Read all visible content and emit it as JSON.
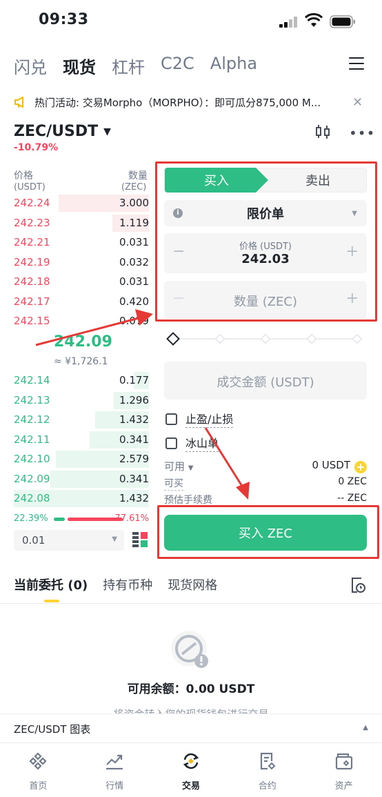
{
  "status": {
    "time": "09:33"
  },
  "top_tabs": [
    {
      "label": "闪兑"
    },
    {
      "label": "现货"
    },
    {
      "label": "杠杆"
    },
    {
      "label": "C2C"
    },
    {
      "label": "Alpha"
    }
  ],
  "notice": {
    "text": "热门活动: 交易Morpho（MORPHO）：即可瓜分875,000 M..."
  },
  "pair": {
    "symbol": "ZEC/USDT",
    "change": "-10.79%"
  },
  "orderbook": {
    "price_header": "价格",
    "price_unit": "(USDT)",
    "qty_header": "数量",
    "qty_unit": "(ZEC)",
    "asks": [
      {
        "price": "242.24",
        "qty": "3.000",
        "depth": 0.67
      },
      {
        "price": "242.23",
        "qty": "1.119",
        "depth": 0.27
      },
      {
        "price": "242.21",
        "qty": "0.031",
        "depth": 0.0
      },
      {
        "price": "242.19",
        "qty": "0.032",
        "depth": 0.0
      },
      {
        "price": "242.18",
        "qty": "0.031",
        "depth": 0.0
      },
      {
        "price": "242.17",
        "qty": "0.420",
        "depth": 0.0
      },
      {
        "price": "242.15",
        "qty": "0.079",
        "depth": 0.0
      }
    ],
    "mid_price": "242.09",
    "mid_fiat": "≈ ¥1,726.1",
    "bids": [
      {
        "price": "242.14",
        "qty": "0.177",
        "depth": 0.11
      },
      {
        "price": "242.13",
        "qty": "1.296",
        "depth": 0.26
      },
      {
        "price": "242.12",
        "qty": "1.432",
        "depth": 0.4
      },
      {
        "price": "242.11",
        "qty": "0.341",
        "depth": 0.44
      },
      {
        "price": "242.10",
        "qty": "2.579",
        "depth": 0.69
      },
      {
        "price": "242.09",
        "qty": "0.341",
        "depth": 0.73
      },
      {
        "price": "242.08",
        "qty": "1.432",
        "depth": 1.0
      }
    ],
    "buy_ratio": "22.39%",
    "sell_ratio": "77.61%",
    "precision": "0.01"
  },
  "form": {
    "buy_label": "买入",
    "sell_label": "卖出",
    "order_type": "限价单",
    "price_label": "价格 (USDT)",
    "price_value": "242.03",
    "qty_placeholder": "数量 (ZEC)",
    "total_placeholder": "成交金额 (USDT)",
    "tpsl_label": "止盈/止损",
    "iceberg_label": "冰山单",
    "available_label": "可用",
    "available_value": "0 USDT",
    "can_buy_label": "可买",
    "can_buy_value": "0 ZEC",
    "fee_label": "预估手续费",
    "fee_value": "-- ZEC",
    "submit_label": "买入 ZEC"
  },
  "orders": {
    "tabs": [
      {
        "label": "当前委托 (0)"
      },
      {
        "label": "持有币种"
      },
      {
        "label": "现货网格"
      }
    ],
    "balance_text": "可用余额：0.00 USDT",
    "tip_text": "将资金转入您的现货钱包进行交易"
  },
  "chart_bar": {
    "label": "ZEC/USDT 图表"
  },
  "bottom_nav": [
    {
      "label": "首页",
      "icon": "home-icon"
    },
    {
      "label": "行情",
      "icon": "markets-icon"
    },
    {
      "label": "交易",
      "icon": "trade-icon"
    },
    {
      "label": "合约",
      "icon": "futures-icon"
    },
    {
      "label": "资产",
      "icon": "wallet-icon"
    }
  ],
  "colors": {
    "buy": "#2ebd85",
    "sell": "#f6465d",
    "accent": "#fcd535",
    "annotation": "#e53935"
  }
}
